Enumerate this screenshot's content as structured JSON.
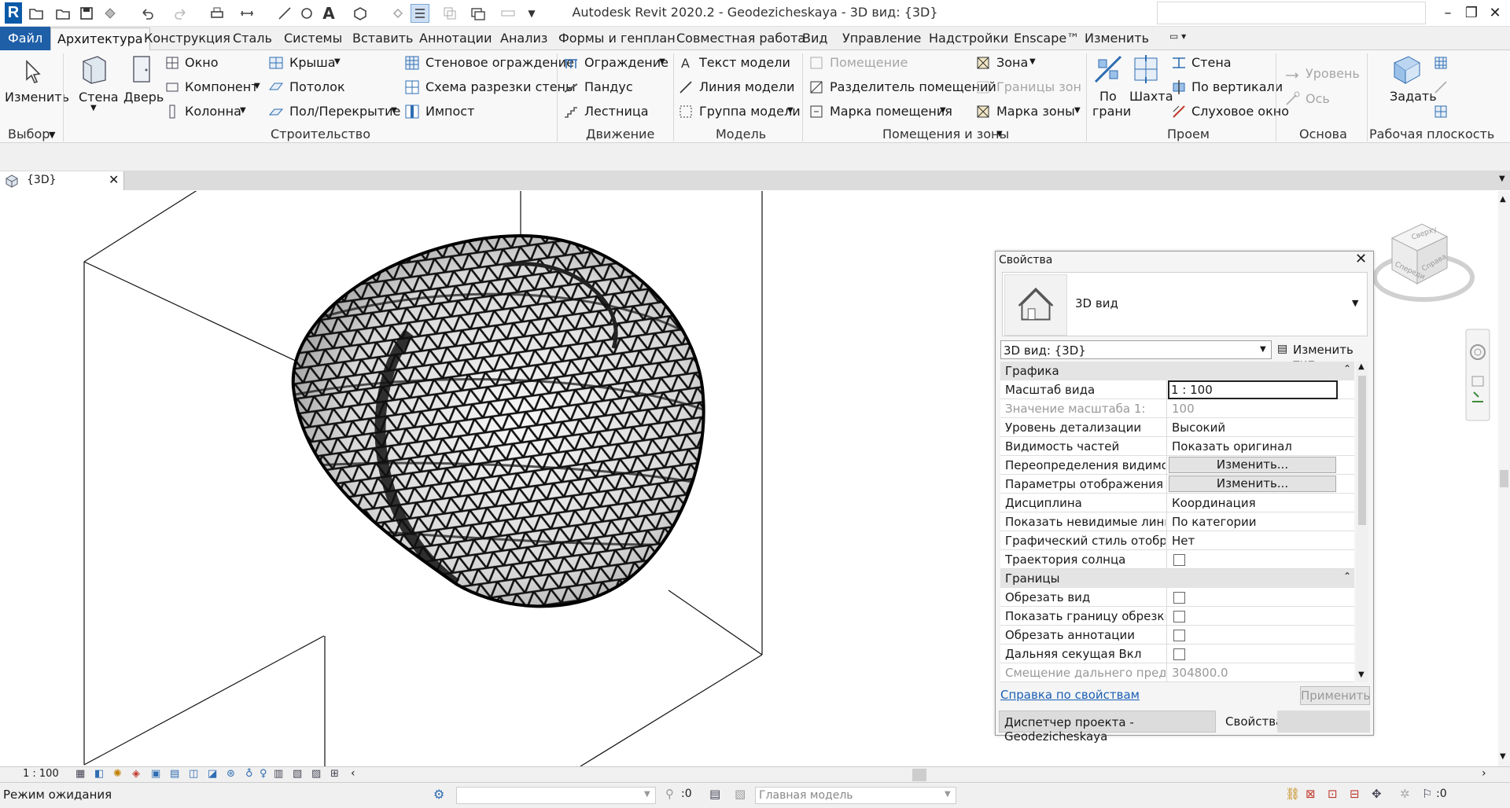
{
  "window": {
    "title": "Autodesk Revit 2020.2 - Geodezicheskaya - 3D вид: {3D}",
    "logo_letter": "R",
    "minimize": "–",
    "maximize": "❐",
    "close": "✕"
  },
  "tabs": [
    "Файл",
    "Архитектура",
    "Конструкция",
    "Сталь",
    "Системы",
    "Вставить",
    "Аннотации",
    "Анализ",
    "Формы и генплан",
    "Совместная работа",
    "Вид",
    "Управление",
    "Надстройки",
    "Enscape™",
    "Изменить"
  ],
  "ribbon": {
    "select": {
      "modify": "Изменить",
      "group": "Выбор"
    },
    "build": {
      "wall": "Стена",
      "door": "Дверь",
      "window": "Окно",
      "component": "Компонент",
      "column": "Колонна",
      "roof": "Крыша",
      "ceiling": "Потолок",
      "floor": "Пол/Перекрытие",
      "curtain_system": "Стеновое ограждение",
      "curtain_grid": "Схема разрезки стены",
      "mullion": "Импост",
      "group": "Строительство"
    },
    "circulation": {
      "railing": "Ограждение",
      "ramp": "Пандус",
      "stair": "Лестница",
      "group": "Движение"
    },
    "model": {
      "model_text": "Текст модели",
      "model_line": "Линия  модели",
      "model_group": "Группа модели",
      "group": "Модель"
    },
    "room": {
      "room": "Помещение",
      "room_separator": "Разделитель помещений",
      "room_tag": "Марка помещения",
      "area": "Зона",
      "area_boundary": "Границы  зон",
      "area_tag": "Марка  зоны",
      "group": "Помещения и зоны"
    },
    "opening": {
      "by_face_1": "По",
      "by_face_2": "грани",
      "shaft": "Шахта",
      "wall": "Стена",
      "vertical": "По вертикали",
      "dormer": "Слуховое окно",
      "group": "Проем"
    },
    "datum": {
      "level": "Уровень",
      "grid": "Ось",
      "group": "Основа"
    },
    "workplane": {
      "set": "Задать",
      "group": "Рабочая плоскость"
    }
  },
  "view_tab": {
    "label": "{3D}",
    "close": "✕"
  },
  "viewcube": {
    "top": "Сверху",
    "front": "Спереди",
    "right": "Справа"
  },
  "properties": {
    "title": "Свойства",
    "type_name": "3D вид",
    "selector": "3D вид: {3D}",
    "edit_type": "Изменить тип",
    "sections": {
      "graphics": "Графика",
      "extents": "Границы"
    },
    "rows": [
      {
        "name": "Масштаб вида",
        "value": "1 : 100"
      },
      {
        "name": "Значение масштаба    1:",
        "value": "100"
      },
      {
        "name": "Уровень детализации",
        "value": "Высокий"
      },
      {
        "name": "Видимость частей",
        "value": "Показать оригинал"
      },
      {
        "name": "Переопределения видимос...",
        "value": "Изменить..."
      },
      {
        "name": "Параметры отображения г...",
        "value": "Изменить..."
      },
      {
        "name": "Дисциплина",
        "value": "Координация"
      },
      {
        "name": "Показать невидимые линии",
        "value": "По категории"
      },
      {
        "name": "Графический стиль отобра...",
        "value": "Нет"
      },
      {
        "name": "Траектория солнца",
        "value": false
      },
      {
        "name": "Обрезать вид",
        "value": false
      },
      {
        "name": "Показать границу обрезки",
        "value": false
      },
      {
        "name": "Обрезать аннотации",
        "value": false
      },
      {
        "name": "Дальняя секущая Вкл",
        "value": false
      },
      {
        "name": "Смещение дальнего предел...",
        "value": "304800.0"
      }
    ],
    "help_link": "Справка по свойствам",
    "apply": "Применить",
    "browser_tab": "Диспетчер проекта - Geodezicheskaya",
    "props_tab": "Свойства"
  },
  "view_status": {
    "scale": "1 : 100"
  },
  "statusbar": {
    "message": "Режим ожидания",
    "selection_count": ":0",
    "model_dropdown": "Главная модель",
    "filter_count": ":0"
  },
  "colors": {
    "file_tab": "#1e5fa8",
    "link": "#1a5fb4"
  }
}
